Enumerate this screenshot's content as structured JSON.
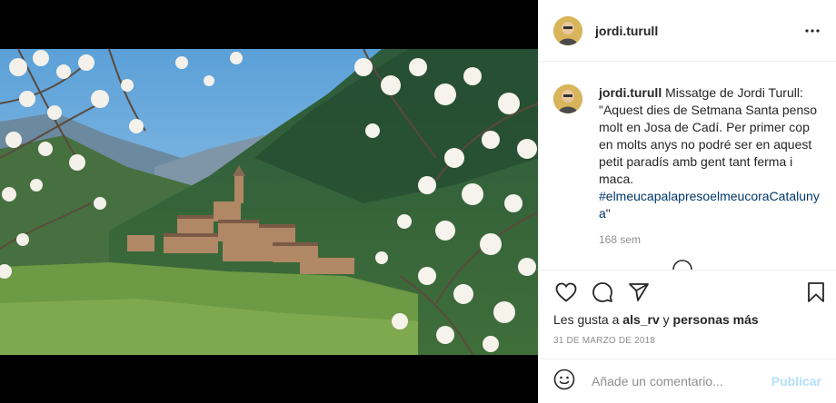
{
  "post": {
    "username": "jordi.turull",
    "header_username": "jordi.turull",
    "caption_lines": [
      "Missatge de Jordi Turull:",
      "\"Aquest dies de Setmana Santa penso",
      "molt en Josa de Cadí. Per primer cop",
      "en molts anys no podré ser en aquest",
      "petit paradís amb gent tant ferma i",
      "maca."
    ],
    "hashtag_lines": [
      "#elmeucapalapresoelmeucoraCataluny",
      "a"
    ],
    "hashtag_tail": "\"",
    "time_ago": "168 sem",
    "likes_prefix": "Les gusta a",
    "likes_user": "als_rv",
    "likes_suffix": "y",
    "likes_others": "personas más",
    "date": "31 DE MARZO DE 2018"
  },
  "comment_box": {
    "placeholder": "Añade un comentario...",
    "publish_label": "Publicar"
  },
  "icons": {
    "more": "more-horizontal-icon",
    "like": "heart-icon",
    "comment": "comment-bubble-icon",
    "share": "paper-plane-icon",
    "save": "bookmark-icon",
    "emoji": "smiley-icon"
  },
  "colors": {
    "text": "#262626",
    "secondary": "#8e8e8e",
    "link": "#00376b",
    "publish_disabled": "#b2dffc",
    "divider": "#efefef"
  }
}
